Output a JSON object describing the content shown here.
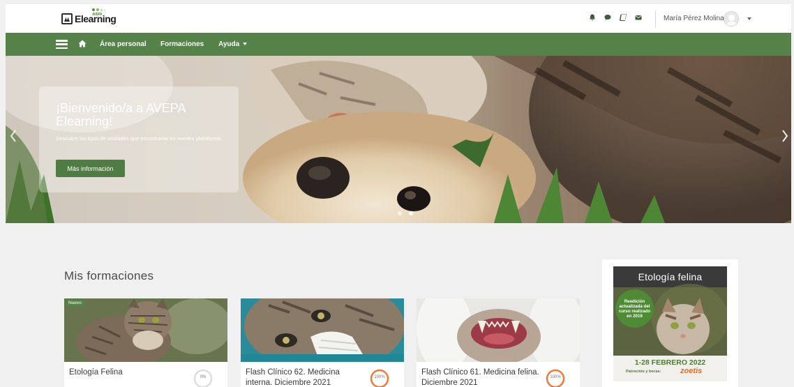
{
  "header": {
    "logo_text": "Elearning",
    "logo_subtext": "AVEPA",
    "user_name": "María Pérez Molina",
    "icons": [
      "bell-icon",
      "chat-icon",
      "book-icon",
      "mail-icon"
    ]
  },
  "nav": {
    "items": [
      {
        "label": "Área personal"
      },
      {
        "label": "Formaciones"
      },
      {
        "label": "Ayuda"
      }
    ]
  },
  "hero": {
    "title": "¡Bienvenido/a a AVEPA Elearning!",
    "description": "Descubre los tipos de unidades que encontrarás en nuestra plataforma.",
    "button_label": "Más información",
    "slide_count": 2,
    "active_slide": 2
  },
  "main": {
    "section_title": "Mis formaciones",
    "courses": [
      {
        "title": "Etología Felina",
        "progress_label": "0%",
        "progress": 0,
        "badge": "Nuevo"
      },
      {
        "title": "Flash Clínico 62. Medicina interna. Diciembre 2021",
        "progress_label": "100%",
        "progress": 100
      },
      {
        "title": "Flash Clínico 61. Medicina felina. Diciembre 2021",
        "progress_label": "100%",
        "progress": 100
      }
    ]
  },
  "sidebar": {
    "promo": {
      "title": "Etología felina",
      "circle_text": "Reedición actualizada del curso realizado en 2019",
      "dates": "1-28 FEBRERO 2022",
      "sponsor": "Patrocinio y becas:",
      "brand": "zoetis"
    }
  },
  "colors": {
    "nav_green": "#558249",
    "button_green": "#4f7c43",
    "progress_orange": "#f2793a",
    "progress_gray": "#dddddd"
  }
}
